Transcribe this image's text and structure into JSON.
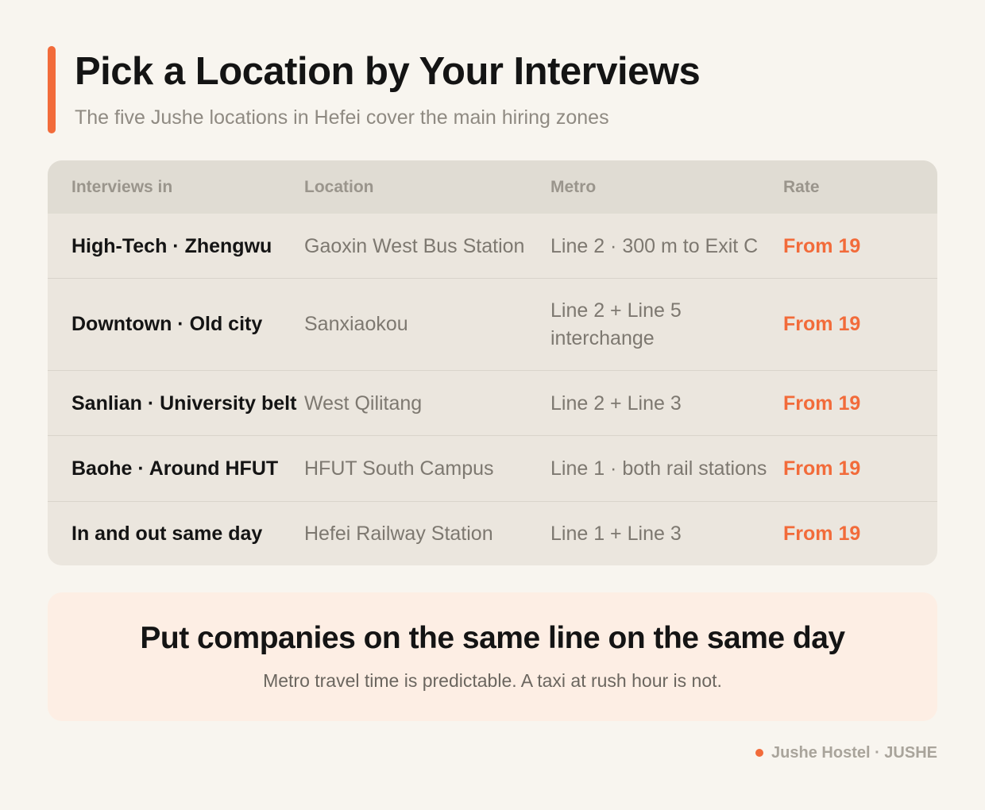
{
  "header": {
    "title": "Pick a Location by Your Interviews",
    "subtitle": "The five Jushe locations in Hefei cover the main hiring zones"
  },
  "table": {
    "columns": [
      "Interviews in",
      "Location",
      "Metro",
      "Rate"
    ],
    "rows": [
      {
        "area": "High-Tech · Zhengwu",
        "location": "Gaoxin West Bus Station",
        "metro": "Line 2 · 300 m to Exit C",
        "rate": "From 19"
      },
      {
        "area": "Downtown · Old city",
        "location": "Sanxiaokou",
        "metro": "Line 2 + Line 5 interchange",
        "rate": "From 19"
      },
      {
        "area": "Sanlian · University belt",
        "location": "West Qilitang",
        "metro": "Line 2 + Line 3",
        "rate": "From 19"
      },
      {
        "area": "Baohe · Around HFUT",
        "location": "HFUT South Campus",
        "metro": "Line 1 · both rail stations",
        "rate": "From 19"
      },
      {
        "area": "In and out same day",
        "location": "Hefei Railway Station",
        "metro": "Line 1 + Line 3",
        "rate": "From 19"
      }
    ]
  },
  "callout": {
    "title": "Put companies on the same line on the same day",
    "text": "Metro travel time is predictable. A taxi at rush hour is not."
  },
  "footer": {
    "brand": "Jushe Hostel · JUSHE"
  },
  "colors": {
    "accent": "#f26b3a",
    "background": "#f8f5ef",
    "table_bg": "#ebe6de",
    "callout_bg": "#fdeee4"
  }
}
